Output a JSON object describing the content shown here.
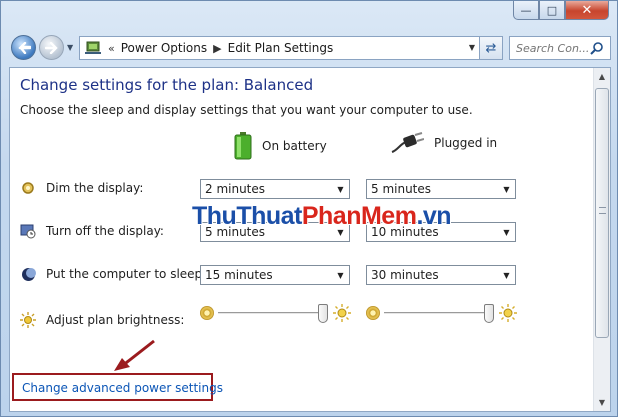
{
  "window": {
    "caption_buttons": {
      "minimize": "—",
      "maximize": "□",
      "close": "✕"
    }
  },
  "nav": {
    "back_icon": "back-arrow-icon",
    "forward_icon": "forward-arrow-icon",
    "address": {
      "overflow": "«",
      "crumbs": [
        "Power Options",
        "Edit Plan Settings"
      ]
    },
    "search_placeholder": "Search Con..."
  },
  "page": {
    "title": "Change settings for the plan: Balanced",
    "subtitle": "Choose the sleep and display settings that you want your computer to use.",
    "columns": {
      "battery": "On battery",
      "plugged": "Plugged in"
    },
    "rows": [
      {
        "label": "Dim the display:",
        "battery": "2 minutes",
        "plugged": "5 minutes"
      },
      {
        "label": "Turn off the display:",
        "battery": "5 minutes",
        "plugged": "10 minutes"
      },
      {
        "label": "Put the computer to sleep:",
        "battery": "15 minutes",
        "plugged": "30 minutes"
      }
    ],
    "brightness": {
      "label": "Adjust plan brightness:",
      "battery_level": 1.0,
      "plugged_level": 1.0
    },
    "advanced_link": "Change advanced power settings"
  },
  "watermark": {
    "part1": "ThuThuat",
    "part2": "PhanMem",
    "part3": ".vn"
  },
  "colors": {
    "title": "#1e3287",
    "link": "#0b55b6",
    "highlight_box": "#9b1b1e"
  }
}
